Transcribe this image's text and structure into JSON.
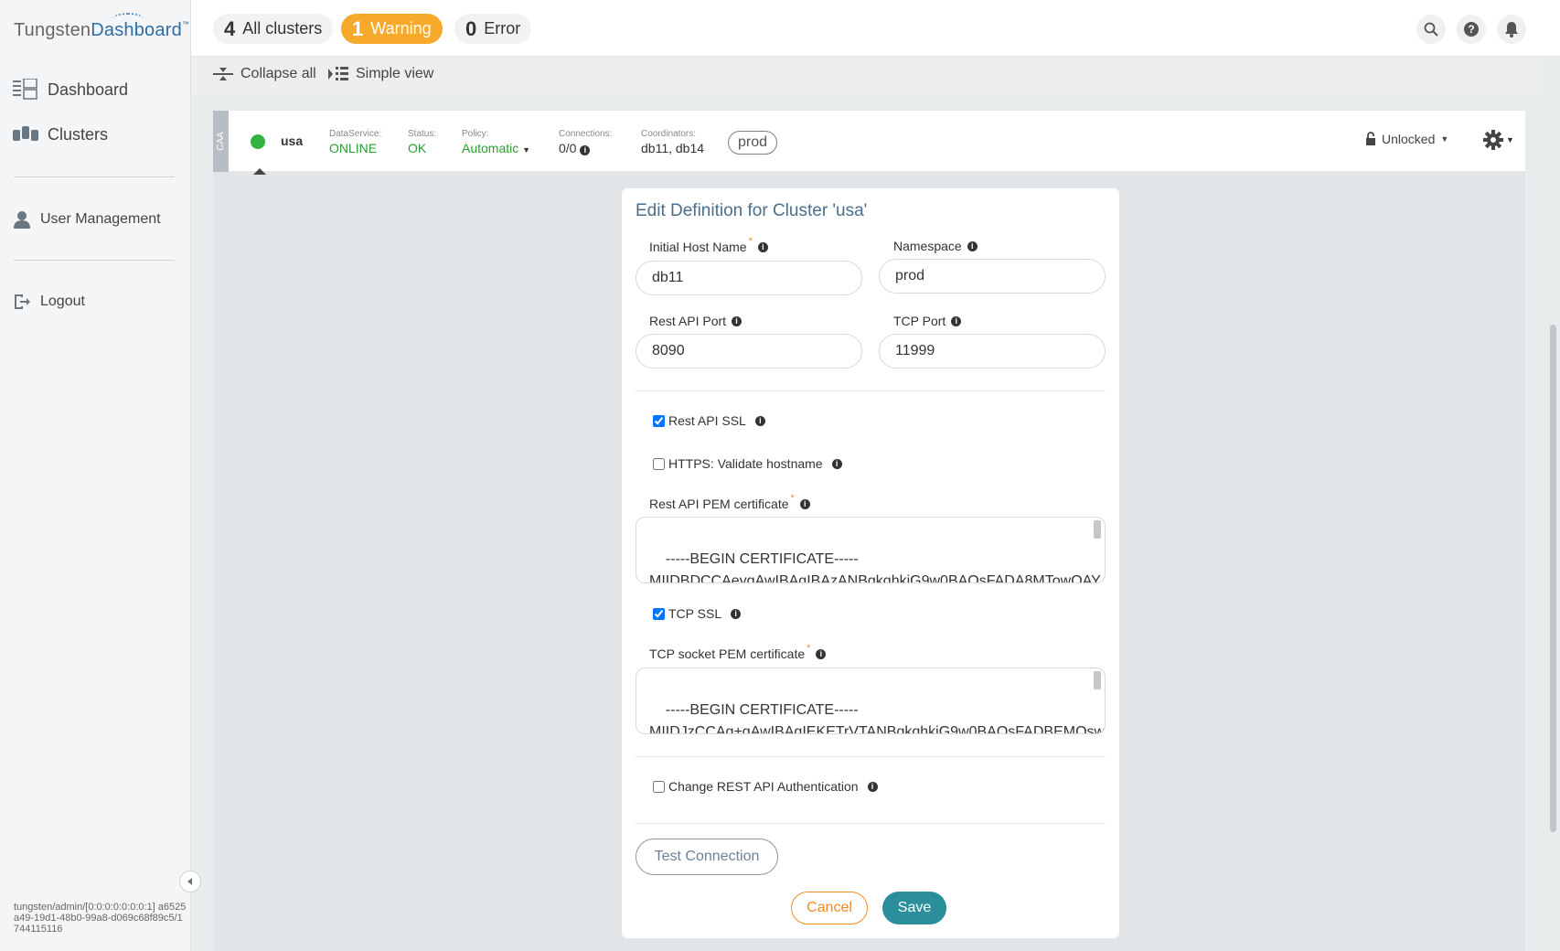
{
  "brand": {
    "part1": "Tungsten",
    "part2": "Dashboard",
    "tm": "™"
  },
  "sidebar": {
    "items": [
      {
        "label": "Dashboard",
        "icon": "dashboard-icon"
      },
      {
        "label": "Clusters",
        "icon": "clusters-icon"
      },
      {
        "label": "User Management",
        "icon": "user-icon"
      },
      {
        "label": "Logout",
        "icon": "logout-icon"
      }
    ],
    "footer": "tungsten/admin/[0:0:0:0:0:0:0:1] a6525a49-19d1-48b0-99a8-d069c68f89c5/1744115116"
  },
  "topbar": {
    "all": {
      "count": "4",
      "label": "All clusters"
    },
    "warning": {
      "count": "1",
      "label": "Warning"
    },
    "error": {
      "count": "0",
      "label": "Error"
    }
  },
  "toolbar": {
    "collapse_all": "Collapse all",
    "simple_view": "Simple view"
  },
  "cluster": {
    "type": "CAA",
    "name": "usa",
    "dataservice_label": "DataService:",
    "dataservice_value": "ONLINE",
    "status_label": "Status:",
    "status_value": "OK",
    "policy_label": "Policy:",
    "policy_value": "Automatic",
    "connections_label": "Connections:",
    "connections_value": "0/0",
    "coordinators_label": "Coordinators:",
    "coordinators_value": "db11, db14",
    "tag": "prod",
    "lock_label": "Unlocked"
  },
  "form": {
    "title": "Edit Definition for Cluster 'usa'",
    "initial_host_label": "Initial Host Name",
    "initial_host_value": "db11",
    "namespace_label": "Namespace",
    "namespace_value": "prod",
    "rest_port_label": "Rest API Port",
    "rest_port_value": "8090",
    "tcp_port_label": "TCP Port",
    "tcp_port_value": "11999",
    "rest_ssl_label": "Rest API SSL",
    "https_validate_label": "HTTPS: Validate hostname",
    "rest_pem_label": "Rest API PEM certificate",
    "rest_pem_value": "-----BEGIN CERTIFICATE-----\nMIIDBDCCAeygAwIBAgIBAzANBgkqhkiG9w0BAQsFADA8MTowOAY",
    "tcp_ssl_label": "TCP SSL",
    "tcp_pem_label": "TCP socket PEM certificate",
    "tcp_pem_value": "-----BEGIN CERTIFICATE-----\nMIIDJzCCAg+gAwIBAgIEKETrVTANBgkqhkiG9w0BAQsFADBEMQsw",
    "change_auth_label": "Change REST API Authentication",
    "test_button": "Test Connection",
    "cancel_button": "Cancel",
    "save_button": "Save"
  }
}
